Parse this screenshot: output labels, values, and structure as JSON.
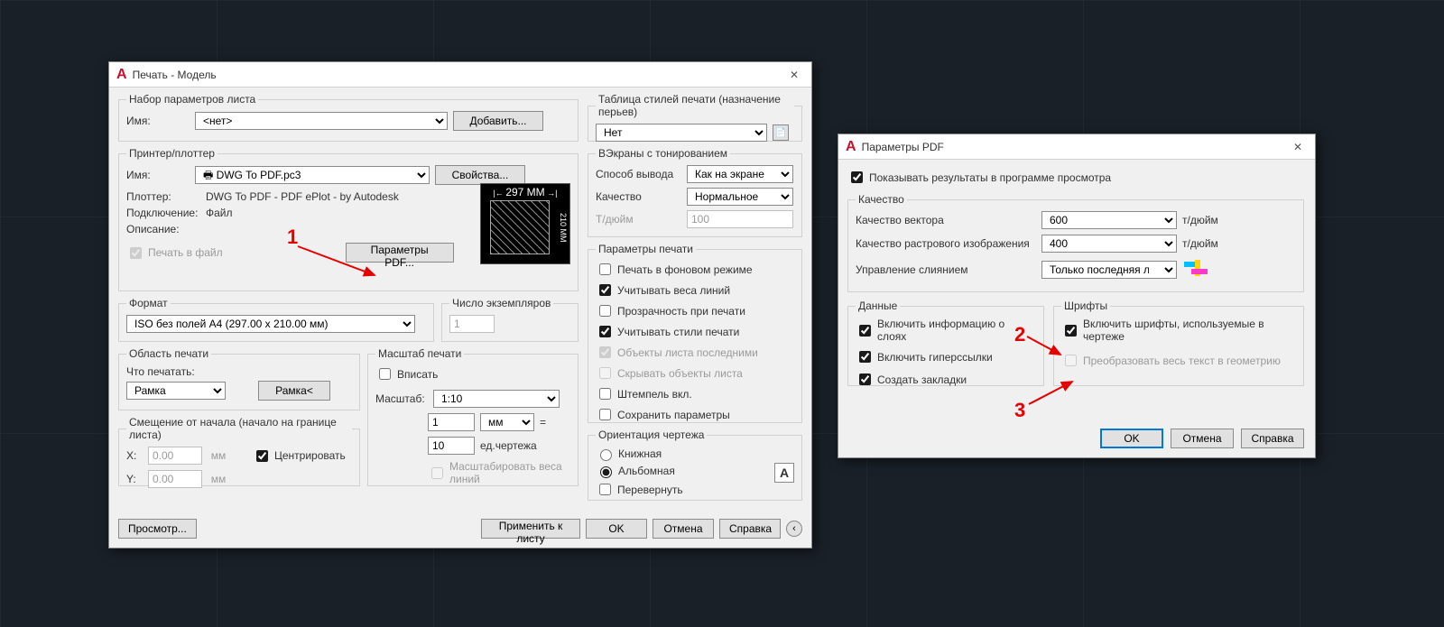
{
  "plot": {
    "title": "Печать - Модель",
    "pageset": {
      "legend": "Набор параметров листа",
      "name_label": "Имя:",
      "name_value": "<нет>",
      "add_btn": "Добавить..."
    },
    "printer": {
      "legend": "Принтер/плоттер",
      "name_label": "Имя:",
      "name_value": "DWG To PDF.pc3",
      "props_btn": "Свойства...",
      "plotter_label": "Плоттер:",
      "plotter_value": "DWG To PDF - PDF ePlot - by Autodesk",
      "conn_label": "Подключение:",
      "conn_value": "Файл",
      "desc_label": "Описание:",
      "plot_to_file": "Печать в файл",
      "pdf_params_btn": "Параметры PDF...",
      "dim_w": "297 MM",
      "dim_h": "210 MM"
    },
    "paper": {
      "legend": "Формат",
      "value": "ISO без полей A4 (297.00 x 210.00 мм)"
    },
    "copies": {
      "legend": "Число экземпляров",
      "value": "1"
    },
    "area": {
      "legend": "Область печати",
      "what_label": "Что печатать:",
      "what_value": "Рамка",
      "window_btn": "Рамка<"
    },
    "offset": {
      "legend": "Смещение от начала (начало на границе листа)",
      "x_label": "X:",
      "x_value": "0.00",
      "x_unit": "мм",
      "y_label": "Y:",
      "y_value": "0.00",
      "y_unit": "мм",
      "center": "Центрировать"
    },
    "scale": {
      "legend": "Масштаб печати",
      "fit": "Вписать",
      "scale_label": "Масштаб:",
      "scale_value": "1:10",
      "num": "1",
      "num_unit": "мм",
      "eq": "=",
      "den": "10",
      "den_unit": "ед.чертежа",
      "scale_lw": "Масштабировать веса линий"
    },
    "styles": {
      "legend": "Таблица стилей печати (назначение перьев)",
      "value": "Нет"
    },
    "shaded": {
      "legend": "ВЭкраны с тонированием",
      "mode_label": "Способ вывода",
      "mode_value": "Как на экране",
      "quality_label": "Качество",
      "quality_value": "Нормальное",
      "dpi_label": "Т/дюйм",
      "dpi_value": "100"
    },
    "plot_opts": {
      "legend": "Параметры печати",
      "bg": "Печать в фоновом режиме",
      "lw": "Учитывать веса линий",
      "trans": "Прозрачность при печати",
      "pstyles": "Учитывать стили печати",
      "psplast": "Объекты листа последними",
      "hidepsp": "Скрывать объекты листа",
      "stamp": "Штемпель вкл.",
      "save": "Сохранить параметры"
    },
    "orient": {
      "legend": "Ориентация чертежа",
      "portrait": "Книжная",
      "landscape": "Альбомная",
      "upside": "Перевернуть"
    },
    "footer": {
      "preview": "Просмотр...",
      "apply": "Применить к листу",
      "ok": "OK",
      "cancel": "Отмена",
      "help": "Справка"
    }
  },
  "pdf": {
    "title": "Параметры PDF",
    "viewer": "Показывать результаты в программе просмотра",
    "quality": {
      "legend": "Качество",
      "vector_label": "Качество вектора",
      "vector_value": "600",
      "vector_unit": "т/дюйм",
      "raster_label": "Качество растрового изображения",
      "raster_value": "400",
      "raster_unit": "т/дюйм",
      "merge_label": "Управление слиянием",
      "merge_value": "Только последняя линия"
    },
    "data": {
      "legend": "Данные",
      "layers": "Включить информацию о слоях",
      "hyper": "Включить гиперссылки",
      "bookmarks": "Создать закладки"
    },
    "fonts": {
      "legend": "Шрифты",
      "include": "Включить шрифты, используемые в чертеже",
      "geom": "Преобразовать весь текст в геометрию"
    },
    "footer": {
      "ok": "OK",
      "cancel": "Отмена",
      "help": "Справка"
    }
  },
  "annotations": {
    "a1": "1",
    "a2": "2",
    "a3": "3"
  }
}
